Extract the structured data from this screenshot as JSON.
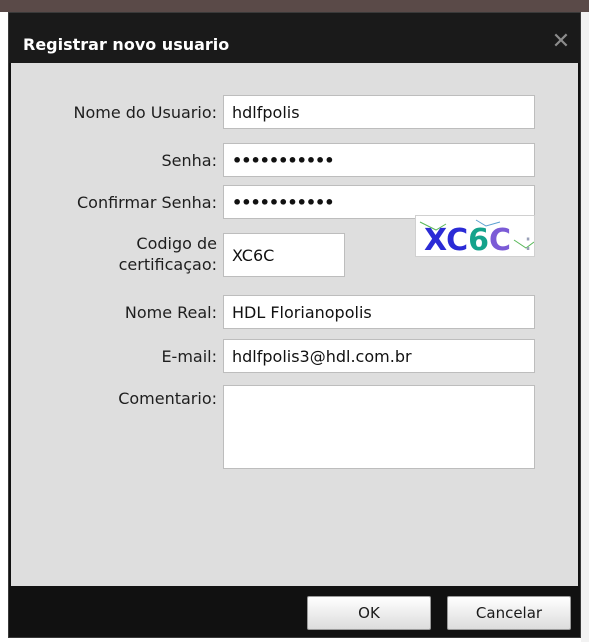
{
  "dialog": {
    "title": "Registrar novo usuario",
    "close_symbol": "✕"
  },
  "form": {
    "username_label": "Nome do Usuario:",
    "username_value": "hdlfpolis",
    "password_label": "Senha:",
    "password_value": "•••••••••••",
    "confirm_label": "Confirmar Senha:",
    "confirm_value": "•••••••••••",
    "cert_label_line1": "Codigo de",
    "cert_label_line2": "certificaçao:",
    "cert_value": "XC6C",
    "captcha_text": "XC6C",
    "realname_label": "Nome Real:",
    "realname_value": "HDL Florianopolis",
    "email_label": "E-mail:",
    "email_value": "hdlfpolis3@hdl.com.br",
    "comment_label": "Comentario:",
    "comment_value": ""
  },
  "buttons": {
    "ok": "OK",
    "cancel": "Cancelar"
  },
  "colors": {
    "dialog_bg": "#111111",
    "content_bg": "#dedede",
    "captcha_x": "#2b2bd6",
    "captcha_c": "#7b5bd6",
    "captcha_6": "#14a38c"
  }
}
